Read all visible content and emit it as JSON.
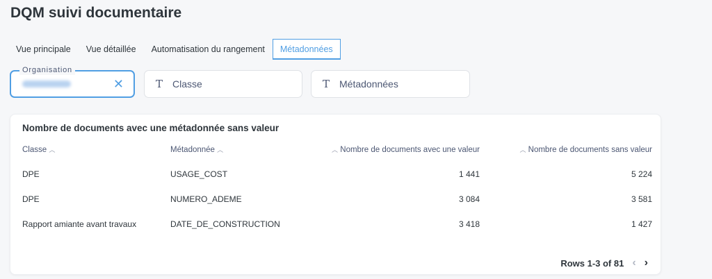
{
  "header": {
    "title": "DQM suivi documentaire"
  },
  "tabs": [
    {
      "label": "Vue principale"
    },
    {
      "label": "Vue détaillée"
    },
    {
      "label": "Automatisation du rangement"
    },
    {
      "label": "Métadonnées"
    }
  ],
  "filters": {
    "organisation": {
      "legend": "Organisation",
      "clear_icon": "close-icon"
    },
    "classe": {
      "label": "Classe",
      "icon": "text-t-icon"
    },
    "metadonnees": {
      "label": "Métadonnées",
      "icon": "text-t-icon"
    }
  },
  "card": {
    "title": "Nombre de documents avec une métadonnée sans valeur",
    "columns": [
      "Classe",
      "Métadonnée",
      "Nombre de documents avec une valeur",
      "Nombre de documents sans valeur"
    ],
    "rows": [
      [
        "DPE",
        "USAGE_COST",
        "1 441",
        "5 224"
      ],
      [
        "DPE",
        "NUMERO_ADEME",
        "3 084",
        "3 581"
      ],
      [
        "Rapport amiante avant travaux",
        "DATE_DE_CONSTRUCTION",
        "3 418",
        "1 427"
      ]
    ],
    "pagination": {
      "label": "Rows 1-3 of 81",
      "prev": "‹",
      "next": "›"
    }
  },
  "colors": {
    "accent": "#509ee3",
    "text": "#2e353b",
    "muted": "#4c5773"
  }
}
